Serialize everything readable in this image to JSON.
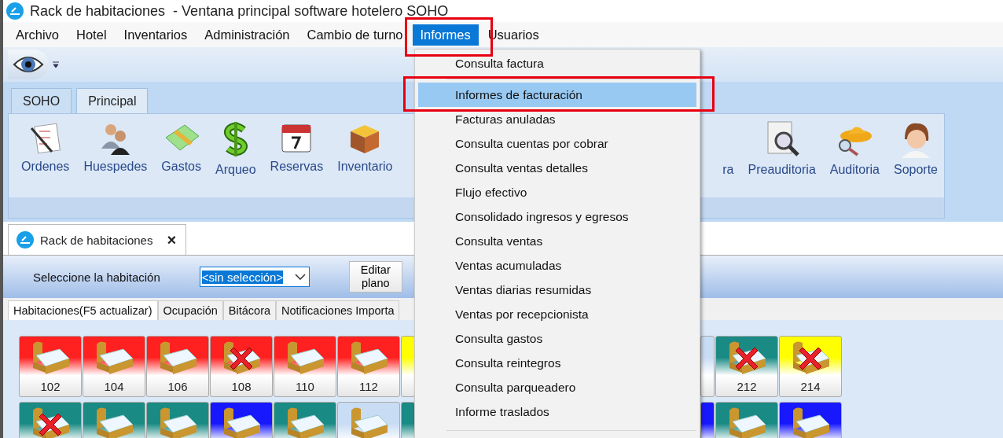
{
  "window": {
    "title": "Rack de habitaciones  - Ventana principal software hotelero SOHO"
  },
  "menu_bar": [
    {
      "label": "Archivo",
      "selected": false
    },
    {
      "label": "Hotel",
      "selected": false
    },
    {
      "label": "Inventarios",
      "selected": false
    },
    {
      "label": "Administración",
      "selected": false
    },
    {
      "label": "Cambio de turno",
      "selected": false
    },
    {
      "label": "Informes",
      "selected": true
    },
    {
      "label": "Usuarios",
      "selected": false
    }
  ],
  "ribbon_tabs": [
    {
      "label": "SOHO",
      "selected": false
    },
    {
      "label": "Principal",
      "selected": true
    }
  ],
  "ribbon_buttons_left": [
    {
      "label": "Ordenes"
    },
    {
      "label": "Huespedes"
    },
    {
      "label": "Gastos"
    },
    {
      "label": "Arqueo"
    },
    {
      "label": "Reservas"
    },
    {
      "label": "Inventario"
    }
  ],
  "ribbon_buttons_right": [
    {
      "label": "ra"
    },
    {
      "label": "Preauditoria"
    },
    {
      "label": "Auditoria"
    },
    {
      "label": "Soporte"
    }
  ],
  "document_tab": {
    "label": "Rack de habitaciones",
    "close": "×"
  },
  "room_selector": {
    "label": "Seleccione la habitación",
    "value": "<sin selección>",
    "button": "Editar plano"
  },
  "sub_tabs": [
    {
      "label": "Habitaciones(F5 actualizar)",
      "selected": true
    },
    {
      "label": "Ocupación",
      "selected": false
    },
    {
      "label": "Bitácora",
      "selected": false
    },
    {
      "label": "Notificaciones Importa",
      "selected": false
    }
  ],
  "rooms_left": [
    [
      {
        "number": "102",
        "color": "#ff2020",
        "blocked": false
      },
      {
        "number": "104",
        "color": "#ff2020",
        "blocked": false
      },
      {
        "number": "106",
        "color": "#ff2020",
        "blocked": false
      },
      {
        "number": "108",
        "color": "#ff2020",
        "blocked": true
      },
      {
        "number": "110",
        "color": "#ff2020",
        "blocked": false
      },
      {
        "number": "112",
        "color": "#ff2020",
        "blocked": false
      },
      {
        "color": "#ffff00"
      }
    ],
    [
      {
        "color": "#1a8a84",
        "blocked": true
      },
      {
        "color": "#1a8a84",
        "blocked": false
      },
      {
        "color": "#1a8a84",
        "blocked": false
      },
      {
        "color": "#1818ff",
        "blocked": false
      },
      {
        "color": "#1a8a84",
        "blocked": false
      },
      {
        "color": "#c8dcf4",
        "blocked": false
      },
      {
        "color": "#1a8a84"
      }
    ]
  ],
  "rooms_right": [
    [
      {
        "color": "#c8dcf4"
      },
      {
        "number": "212",
        "color": "#1a8a84",
        "blocked": true
      },
      {
        "number": "214",
        "color": "#ffff00",
        "blocked": true
      }
    ],
    [
      {
        "color": "#1818ff"
      },
      {
        "color": "#1a8a84",
        "blocked": false
      },
      {
        "color": "#1818ff",
        "blocked": false
      }
    ]
  ],
  "dropdown_menu": [
    {
      "label": "Consulta factura",
      "selected": false
    },
    {
      "label": "Informes de facturación",
      "selected": true
    },
    {
      "label": "Facturas anuladas",
      "selected": false
    },
    {
      "label": "Consulta cuentas por cobrar",
      "selected": false
    },
    {
      "label": "Consulta ventas detalles",
      "selected": false
    },
    {
      "label": "Flujo efectivo",
      "selected": false
    },
    {
      "label": "Consolidado ingresos y egresos",
      "selected": false
    },
    {
      "label": "Consulta ventas",
      "selected": false
    },
    {
      "label": "Ventas acumuladas",
      "selected": false
    },
    {
      "label": "Ventas diarias resumidas",
      "selected": false
    },
    {
      "label": "Ventas por recepcionista",
      "selected": false
    },
    {
      "label": "Consulta gastos",
      "selected": false
    },
    {
      "label": "Consulta reintegros",
      "selected": false
    },
    {
      "label": "Consulta parqueadero",
      "selected": false
    },
    {
      "label": "Informe traslados",
      "selected": false
    }
  ]
}
